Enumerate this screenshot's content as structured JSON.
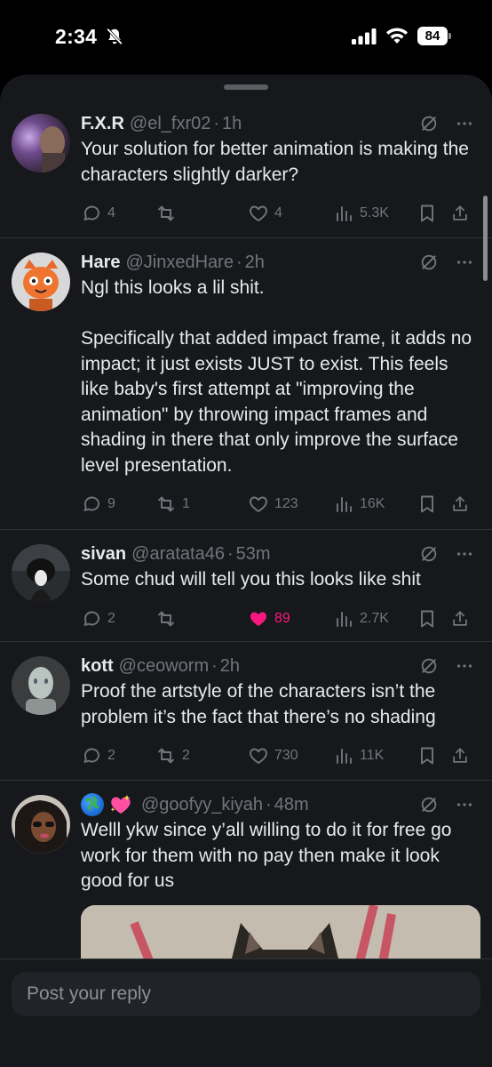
{
  "status": {
    "time": "2:34",
    "battery": "84"
  },
  "replies": [
    {
      "name": "F.X.R",
      "handle": "@el_fxr02",
      "time": "1h",
      "text": "Your solution for better animation is making the characters slightly darker?",
      "replies": "4",
      "reposts": "",
      "likes": "4",
      "views": "5.3K",
      "liked": false
    },
    {
      "name": "Hare",
      "handle": "@JinxedHare",
      "time": "2h",
      "text": "Ngl this looks a lil shit.\n\nSpecifically that added impact frame, it adds no impact; it just exists JUST to exist. This feels like baby's first attempt at \"improving the animation\" by throwing impact frames and shading in there that only improve the surface level presentation.",
      "replies": "9",
      "reposts": "1",
      "likes": "123",
      "views": "16K",
      "liked": false
    },
    {
      "name": "sivan",
      "handle": "@aratata46",
      "time": "53m",
      "text": "Some chud will tell you this looks like shit",
      "replies": "2",
      "reposts": "",
      "likes": "89",
      "views": "2.7K",
      "liked": true
    },
    {
      "name": "kott",
      "handle": "@ceoworm",
      "time": "2h",
      "text": "Proof the artstyle of the characters isn’t the problem it’s the fact that there’s no shading",
      "replies": "2",
      "reposts": "2",
      "likes": "730",
      "views": "11K",
      "liked": false
    },
    {
      "name": "",
      "handle": "@goofyy_kiyah",
      "time": "48m",
      "text": "Welll ykw since y’all willing to do it for free go work for them with no pay then make it look good for us",
      "name_icons": [
        "globe-emoji-icon",
        "sparkling-heart-emoji-icon"
      ]
    }
  ],
  "reply_box": {
    "placeholder": "Post your reply"
  },
  "colors": {
    "background": "#16181c",
    "text": "#e7e9ea",
    "muted": "#71767b",
    "like_active": "#f91880",
    "divider": "#2f3336"
  }
}
